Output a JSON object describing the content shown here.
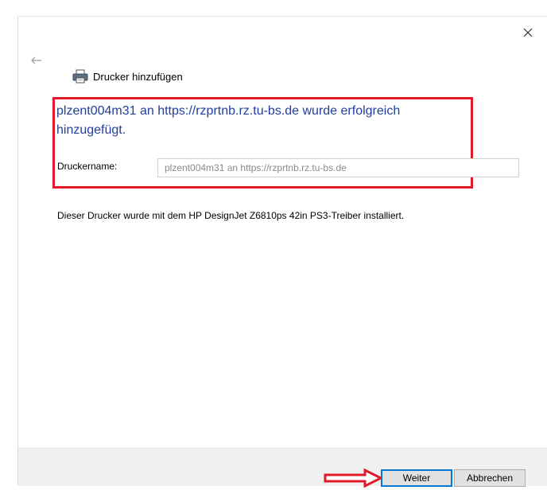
{
  "window": {
    "title": "Drucker hinzufügen",
    "close_icon": "close-icon",
    "back_icon": "back-arrow-icon"
  },
  "main": {
    "success_message": "plzent004m31 an https://rzprtnb.rz.tu-bs.de wurde erfolgreich hinzugefügt.",
    "printer_name_label": "Druckername:",
    "printer_name_value": "plzent004m31 an https://rzprtnb.rz.tu-bs.de",
    "driver_info": "Dieser Drucker wurde mit dem HP DesignJet Z6810ps 42in PS3-Treiber installiert."
  },
  "footer": {
    "next_label": "Weiter",
    "cancel_label": "Abbrechen"
  },
  "colors": {
    "accent": "#0078d7",
    "highlight": "#e01a2b",
    "success_text": "#1f3e9e"
  }
}
